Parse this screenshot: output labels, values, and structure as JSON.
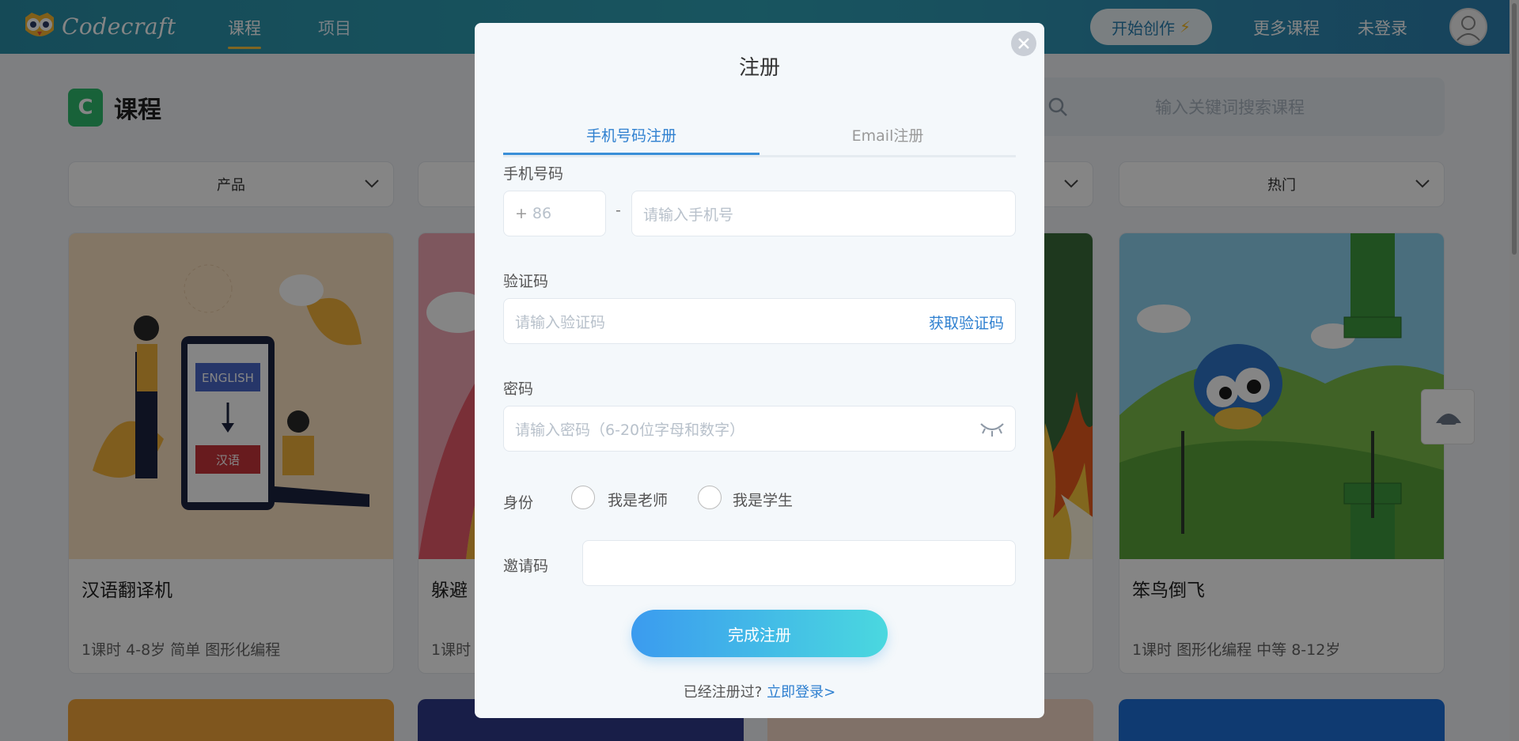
{
  "topbar": {
    "logo_text": "Codecraft",
    "nav": [
      {
        "label": "课程",
        "active": true
      },
      {
        "label": "项目",
        "active": false
      }
    ],
    "start_label": "开始创作",
    "more_courses": "更多课程",
    "not_logged_in": "未登录"
  },
  "page": {
    "icon_letter": "C",
    "title": "课程",
    "search_placeholder": "输入关键词搜索课程",
    "filters": [
      "产品",
      "热门"
    ],
    "cards": [
      {
        "title": "汉语翻译机",
        "meta": "1课时 4-8岁 简单 图形化编程",
        "img_word_top": "ENGLISH",
        "img_word_bottom": "汉语"
      },
      {
        "title": "躲避",
        "meta": "1课时"
      },
      {
        "title": "",
        "meta": ""
      },
      {
        "title": "笨鸟倒飞",
        "meta": "1课时 图形化编程 中等 8-12岁"
      }
    ]
  },
  "modal": {
    "title": "注册",
    "tabs": [
      {
        "label": "手机号码注册",
        "active": true
      },
      {
        "label": "Email注册",
        "active": false
      }
    ],
    "phone": {
      "label": "手机号码",
      "country_code": "86",
      "separator": "-",
      "placeholder": "请输入手机号"
    },
    "code": {
      "label": "验证码",
      "placeholder": "请输入验证码",
      "get_code": "获取验证码"
    },
    "password": {
      "label": "密码",
      "placeholder": "请输入密码（6-20位字母和数字）"
    },
    "identity": {
      "label": "身份",
      "options": [
        "我是老师",
        "我是学生"
      ]
    },
    "invite": {
      "label": "邀请码",
      "value": ""
    },
    "submit_label": "完成注册",
    "login_prompt": "已经注册过?",
    "login_link": "立即登录>"
  },
  "colors": {
    "accent": "#2f80d0",
    "topbar": "#2fa3b7",
    "submit_from": "#3b9bef",
    "submit_to": "#4ad8df"
  }
}
